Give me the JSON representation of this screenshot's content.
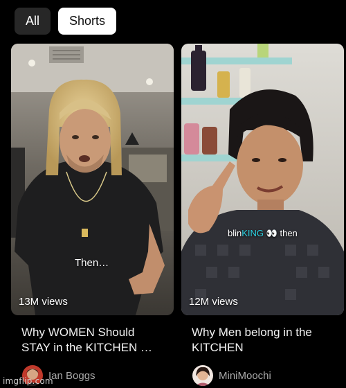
{
  "filter_chips": {
    "all_label": "All",
    "shorts_label": "Shorts",
    "selected": "Shorts"
  },
  "videos": [
    {
      "views": "13M views",
      "title_line1": "Why WOMEN Should",
      "title_line2": "STAY in the KITCHEN …",
      "channel": "Ian Boggs",
      "caption": "Then…"
    },
    {
      "views": "12M views",
      "title_line1": "Why Men belong in the",
      "title_line2": "KITCHEN",
      "channel": "MiniMoochi",
      "caption_pre": "blin",
      "caption_highlight": "KING",
      "caption_emoji": "👀",
      "caption_post": "then"
    }
  ],
  "watermark": "imgflip.com",
  "colors": {
    "chip_active_bg": "#ffffff",
    "chip_inactive_bg": "#272727",
    "caption_highlight": "#2bd0e0"
  }
}
